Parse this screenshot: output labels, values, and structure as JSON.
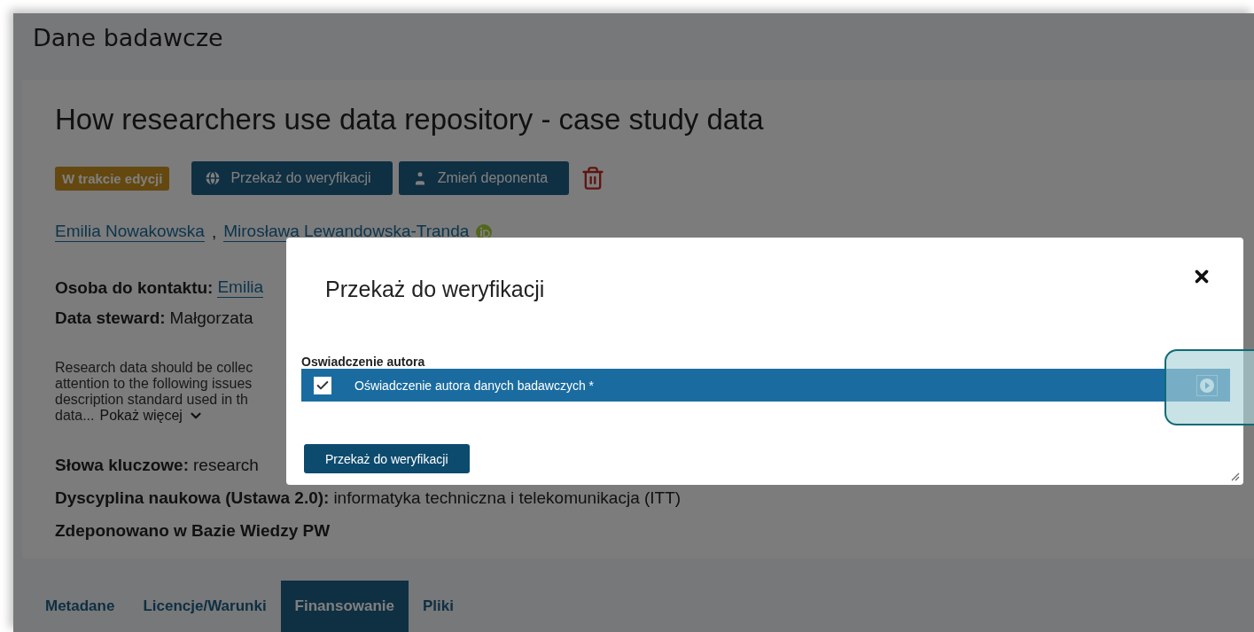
{
  "page": {
    "title": "Dane badawcze"
  },
  "record": {
    "title": "How researchers use data repository - case study data",
    "status_badge": "W trakcie edycji",
    "actions": [
      {
        "label": "Przekaż do weryfikacji",
        "kind": "globe"
      },
      {
        "label": "Zmień deponenta",
        "kind": "user"
      }
    ]
  },
  "authors": [
    {
      "name": "Emilia Nowakowska",
      "suffix": ",",
      "orcid": false
    },
    {
      "name": "Mirosława Lewandowska-Tranda",
      "orcid": true
    }
  ],
  "contacts": [
    {
      "label": "Osoba do kontaktu:",
      "value": "Emilia",
      "link": true
    },
    {
      "label": "Data steward:",
      "value": "Małgorzata",
      "link": false
    }
  ],
  "description": {
    "lines": [
      "Research data should be collec",
      "attention to the following issues",
      "description standard used in th",
      "data..."
    ],
    "more": "Pokaż więcej"
  },
  "details": [
    {
      "label": "Słowa kluczowe:",
      "value": "research"
    },
    {
      "label": "Dyscyplina naukowa (Ustawa 2.0):",
      "value": "informatyka techniczna i telekomunikacja (ITT)"
    },
    {
      "label": "Zdeponowano w Bazie Wiedzy PW"
    }
  ],
  "tabs": [
    {
      "label": "Metadane",
      "selected": false
    },
    {
      "label": "Licencje/Warunki",
      "selected": false
    },
    {
      "label": "Finansowanie",
      "selected": true
    },
    {
      "label": "Pliki",
      "selected": false
    }
  ],
  "modal": {
    "title": "Przekaż do weryfikacji",
    "section": "Oswiadczenie autora",
    "items": [
      {
        "label": "Oświadczenie autora danych badawczych *",
        "checked": true,
        "selected": true
      }
    ],
    "submit": "Przekaż do weryfikacji"
  }
}
